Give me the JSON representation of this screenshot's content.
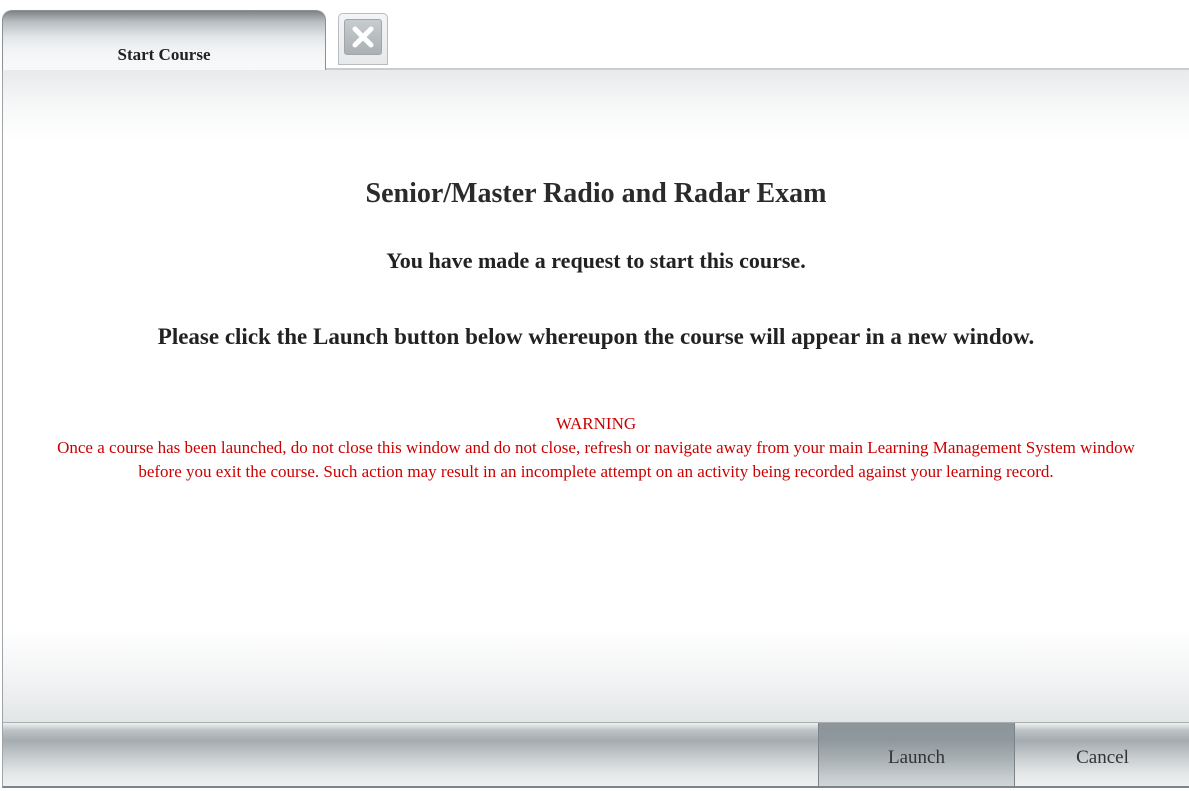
{
  "tabs": {
    "active_label": "Start Course"
  },
  "main": {
    "course_title": "Senior/Master Radio and Radar Exam",
    "request_message": "You have made a request to start this course.",
    "launch_instructions": "Please click the Launch button below whereupon the course will appear in a new window.",
    "warning": {
      "title": "WARNING",
      "text": "Once a course has been launched, do not close this window and do not close, refresh or navigate away from your main Learning Management System window before you exit the course. Such action may result in an incomplete attempt on an activity being recorded against your learning record."
    }
  },
  "footer": {
    "launch_label": "Launch",
    "cancel_label": "Cancel"
  },
  "colors": {
    "warning": "#cc0000",
    "tab_gradient_top": "#7b8286",
    "footer_bar": "#a5acb0"
  },
  "icons": {
    "close": "close-icon"
  }
}
